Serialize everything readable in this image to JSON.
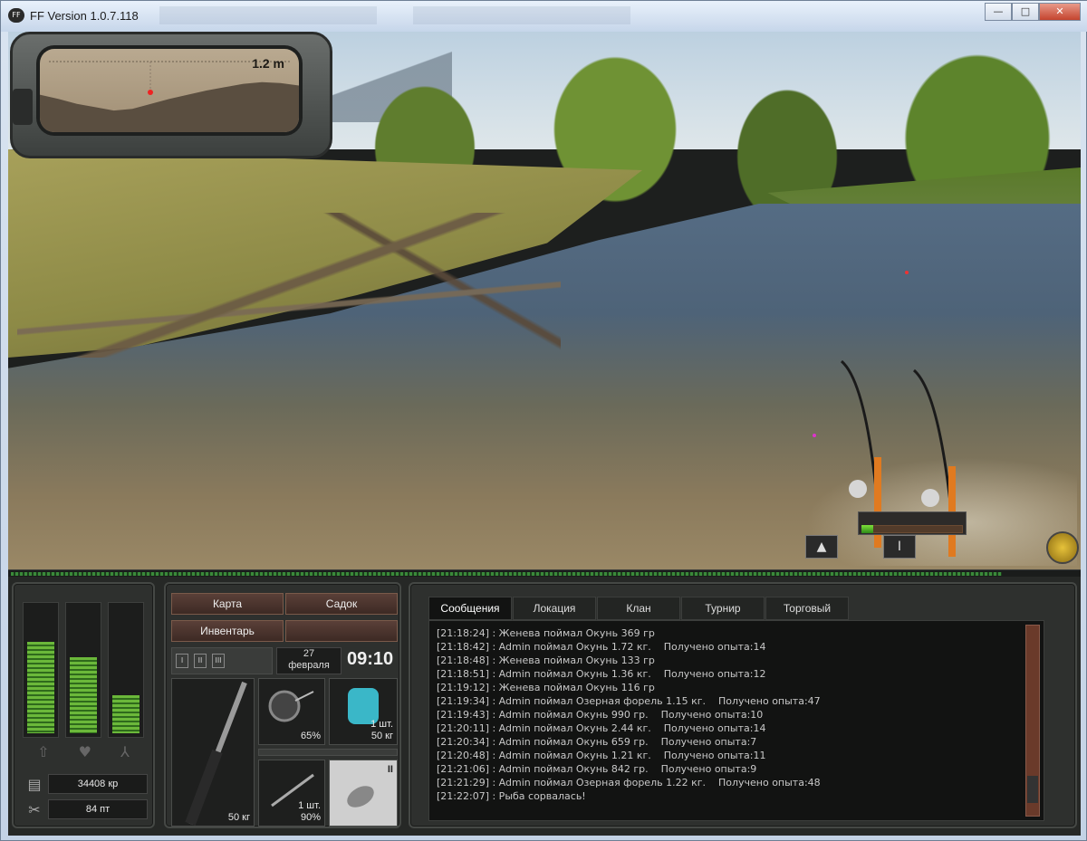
{
  "window": {
    "title": "FF Version 1.0.7.118",
    "icon_text": "FF",
    "buttons": {
      "minimize": "—",
      "maximize": "□",
      "close": "✕"
    }
  },
  "depth_meter": {
    "value": "1.2 m",
    "profile": [
      0.55,
      0.6,
      0.66,
      0.7,
      0.74,
      0.72,
      0.66,
      0.6,
      0.55,
      0.5,
      0.46,
      0.42,
      0.4,
      0.41,
      0.44
    ]
  },
  "rods": {
    "active_button": "I",
    "tension": 0.12,
    "rod_icon": "rod-spinning-icon"
  },
  "progress_strip": 0.93,
  "stats": {
    "bars": [
      0.72,
      0.6,
      0.3
    ],
    "icons": [
      "up-arrow-icon",
      "heart-icon",
      "branch-icon"
    ],
    "money": {
      "credits": "34408 кр",
      "points": "84 пт"
    }
  },
  "menu": {
    "map": "Карта",
    "keepnet": "Садок",
    "inventory": "Инвентарь",
    "empty": ""
  },
  "datetime": {
    "day": "27",
    "month": "февраля",
    "time": "09:10"
  },
  "view_buttons": [
    "I",
    "II",
    "III"
  ],
  "slots": {
    "rod": {
      "label": "50 кг"
    },
    "reel": {
      "label": "65%"
    },
    "bait": {
      "label1": "1 шт.",
      "label2": "50 кг"
    },
    "hook": {
      "label1": "1 шт.",
      "label2": "90%"
    },
    "lure": {
      "label": "II"
    }
  },
  "chat": {
    "tabs": [
      "Сообщения",
      "Локация",
      "Клан",
      "Турнир",
      "Торговый"
    ],
    "lines": [
      "[21:18:24] : Женева поймал Окунь 369 гр",
      "[21:18:42] : Admin поймал Окунь 1.72 кг.    Получено опыта:14",
      "[21:18:48] : Женева поймал Окунь 133 гр",
      "[21:18:51] : Admin поймал Окунь 1.36 кг.    Получено опыта:12",
      "[21:19:12] : Женева поймал Окунь 116 гр",
      "[21:19:34] : Admin поймал Озерная форель 1.15 кг.    Получено опыта:47",
      "[21:19:43] : Admin поймал Окунь 990 гр.    Получено опыта:10",
      "[21:20:11] : Admin поймал Окунь 2.44 кг.    Получено опыта:14",
      "[21:20:34] : Admin поймал Окунь 659 гр.    Получено опыта:7",
      "[21:20:48] : Admin поймал Окунь 1.21 кг.    Получено опыта:11",
      "[21:21:06] : Admin поймал Окунь 842 гр.    Получено опыта:9",
      "[21:21:29] : Admin поймал Озерная форель 1.22 кг.    Получено опыта:48",
      "[21:22:07] : Рыба сорвалась!"
    ]
  }
}
